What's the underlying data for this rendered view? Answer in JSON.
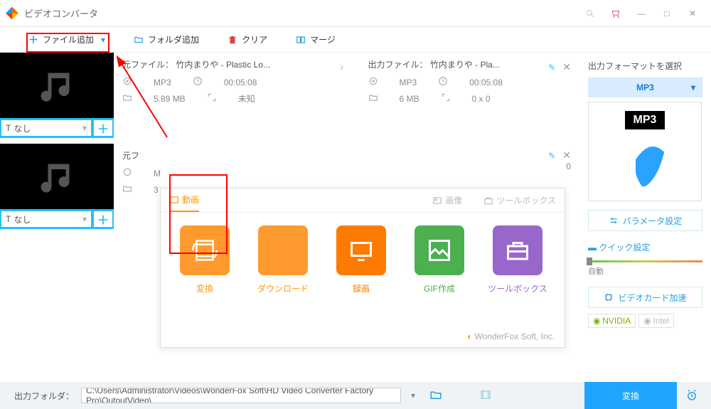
{
  "titlebar": {
    "title": "ビデオコンバータ"
  },
  "toolbar": {
    "add_file": "ファイル追加",
    "add_folder": "フォルダ追加",
    "clear": "クリア",
    "merge": "マージ"
  },
  "items": [
    {
      "subtitle": "なし",
      "src_name": "元ファイル： 竹内まりや - Plastic Lo...",
      "src_format": "MP3",
      "src_duration": "00:05:08",
      "src_size": "5.89 MB",
      "src_res": "未知",
      "out_name": "出力ファイル： 竹内まりや - Pla...",
      "out_format": "MP3",
      "out_duration": "00:05:08",
      "out_size": "6 MB",
      "out_res": "0 x 0"
    },
    {
      "subtitle": "なし",
      "src_name": "元フ",
      "src_format": "M",
      "src_duration": "",
      "src_size": "3",
      "src_res": "",
      "out_name": "",
      "out_format": "",
      "out_duration": "",
      "out_size": "0",
      "out_res": ""
    }
  ],
  "popup": {
    "tab_video": "動画",
    "tab_image": "画像",
    "tab_toolbox": "ツールボックス",
    "convert": "変換",
    "download": "ダウンロード",
    "record": "録画",
    "gif": "GIF作成",
    "toolbox": "ツールボックス",
    "footer": "WonderFox Soft, Inc."
  },
  "sidebar": {
    "title": "出力フォーマットを選択",
    "format": "MP3",
    "badge": "MP3",
    "param_btn": "パラメータ設定",
    "quick_title": "クイック設定",
    "slider_label": "自動",
    "gpu_btn": "ビデオカード加速",
    "chip_nvidia": "NVIDIA",
    "chip_intel": "Intel"
  },
  "bottom": {
    "label": "出力フォルダ：",
    "path": "C:\\Users\\Administrator\\Videos\\WonderFox Soft\\HD Video Converter Factory Pro\\OutputVideo\\",
    "convert": "変換"
  }
}
